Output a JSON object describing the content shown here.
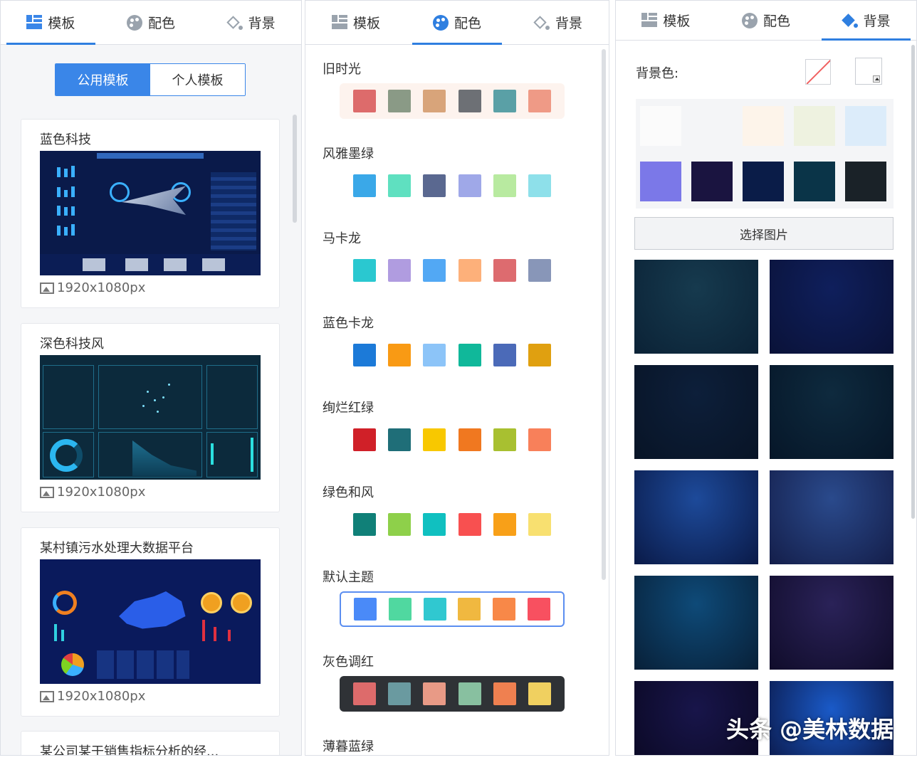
{
  "tabs": {
    "template": "模板",
    "color": "配色",
    "background": "背景"
  },
  "template_panel": {
    "segment": {
      "public": "公用模板",
      "personal": "个人模板"
    },
    "cards": [
      {
        "title": "蓝色科技",
        "size": "1920x1080px"
      },
      {
        "title": "深色科技风",
        "size": "1920x1080px"
      },
      {
        "title": "某村镇污水处理大数据平台",
        "size": "1920x1080px"
      },
      {
        "title": "某公司某干销售指标分析的经..."
      }
    ]
  },
  "color_panel": {
    "schemes": [
      {
        "name": "旧时光",
        "colors": [
          "#dd6b6b",
          "#8a9a86",
          "#d8a47a",
          "#6d7075",
          "#5aa0a6",
          "#ef9a86"
        ],
        "style": "warm"
      },
      {
        "name": "风雅墨绿",
        "colors": [
          "#3aa8e8",
          "#5fe0c0",
          "#5a6890",
          "#9fa8e8",
          "#b8eaa0",
          "#8ee0ea"
        ],
        "style": ""
      },
      {
        "name": "马卡龙",
        "colors": [
          "#2ac8d0",
          "#b09ce0",
          "#52a8f4",
          "#fdb07a",
          "#dd6b6f",
          "#8896b8"
        ],
        "style": ""
      },
      {
        "name": "蓝色卡龙",
        "colors": [
          "#1c7ad8",
          "#f99a14",
          "#8cc4f8",
          "#10b89a",
          "#4b6ab8",
          "#e0a010"
        ],
        "style": ""
      },
      {
        "name": "绚烂红绿",
        "colors": [
          "#d02028",
          "#1f6e78",
          "#f8c800",
          "#f07820",
          "#a8c030",
          "#f8805a"
        ],
        "style": ""
      },
      {
        "name": "绿色和风",
        "colors": [
          "#108078",
          "#8ed04a",
          "#10c0c0",
          "#f85050",
          "#f8a018",
          "#f8e070"
        ],
        "style": ""
      },
      {
        "name": "默认主题",
        "colors": [
          "#4a8af8",
          "#50d8a0",
          "#30c8d0",
          "#f0b840",
          "#f88848",
          "#f85060"
        ],
        "style": "selected"
      },
      {
        "name": "灰色调红",
        "colors": [
          "#dd6b6b",
          "#6a9aa0",
          "#e89a86",
          "#88c0a0",
          "#ef8050",
          "#f0d060"
        ],
        "style": "dark"
      },
      {
        "name": "薄暮蓝绿"
      }
    ]
  },
  "background_panel": {
    "label": "背景色:",
    "swatches_row1": [
      "#fbfbfb",
      "#f4f5f7",
      "#fdf4ea",
      "#eef2e0",
      "#dcecfa"
    ],
    "swatches_row2": [
      "#7b78e8",
      "#1a1440",
      "#0a1c48",
      "#0a3448",
      "#1a2228"
    ],
    "choose_button": "选择图片",
    "images": [
      {
        "from": "#163a4e",
        "to": "#0b2236"
      },
      {
        "from": "#0f1f5c",
        "to": "#0a1238"
      },
      {
        "from": "#0d1f3a",
        "to": "#081426"
      },
      {
        "from": "#0e2a3e",
        "to": "#061628"
      },
      {
        "from": "#1d4a9a",
        "to": "#0a1a48"
      },
      {
        "from": "#2a4a8c",
        "to": "#141e4a"
      },
      {
        "from": "#0e4a78",
        "to": "#082038"
      },
      {
        "from": "#2a2258",
        "to": "#100c2a"
      },
      {
        "from": "#18154a",
        "to": "#0a0822"
      },
      {
        "from": "#1a5ac8",
        "to": "#0a1440"
      }
    ]
  },
  "watermark": "头条 @美林数据"
}
